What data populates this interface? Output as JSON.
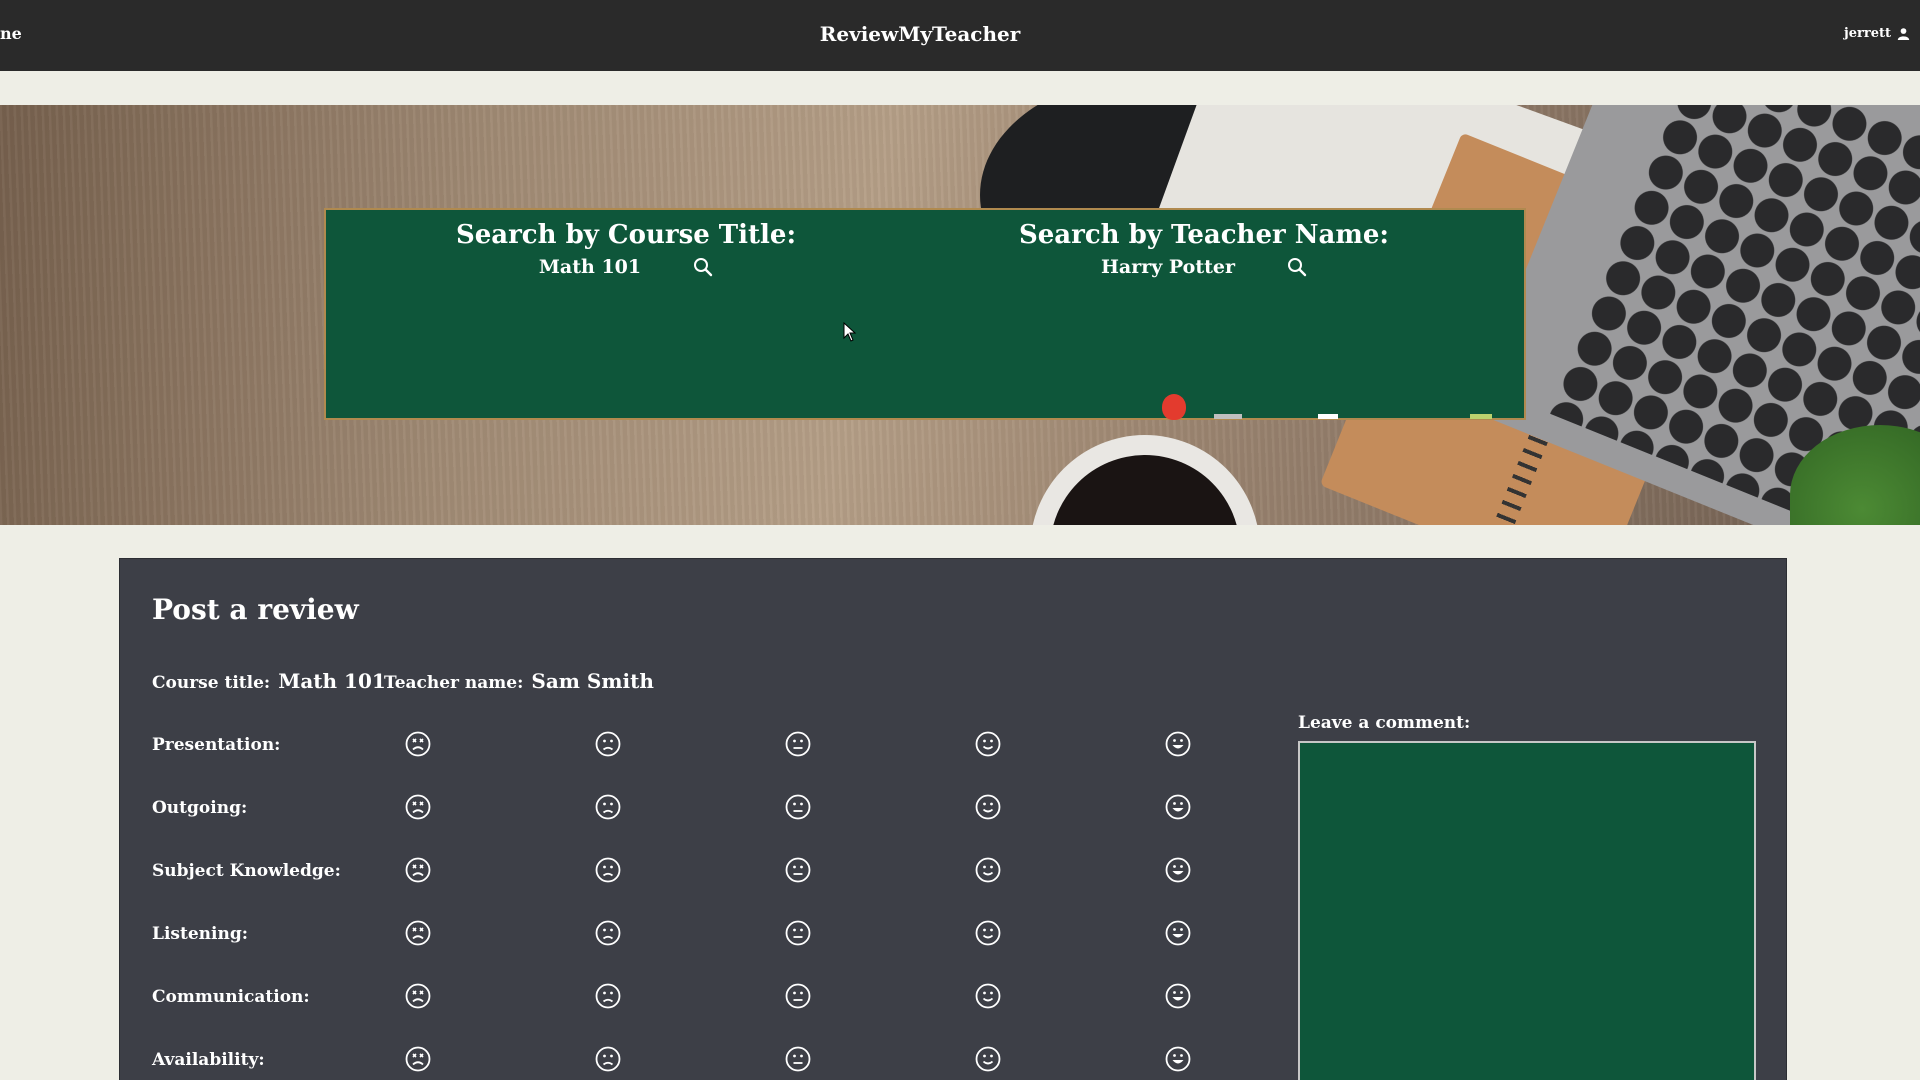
{
  "nav": {
    "home_label": "ne",
    "brand": "ReviewMyTeacher",
    "username": "jerrett"
  },
  "search": {
    "course_heading": "Search by Course Title:",
    "course_value": "Math 101",
    "teacher_heading": "Search by Teacher Name:",
    "teacher_value": "Harry Potter"
  },
  "review": {
    "title": "Post a review",
    "course_label": "Course title:",
    "course_value": "Math 101",
    "teacher_label": "Teacher name:",
    "teacher_value": "Sam Smith",
    "criteria": [
      "Presentation:",
      "Outgoing:",
      "Subject Knowledge:",
      "Listening:",
      "Communication:",
      "Availability:"
    ],
    "rating_icons": [
      "very-sad-face-icon",
      "sad-face-icon",
      "neutral-face-icon",
      "smile-face-icon",
      "big-smile-face-icon"
    ],
    "comment_label": "Leave a comment:"
  },
  "colors": {
    "nav_bg": "#2a2a2a",
    "chalkboard": "#0e563a",
    "panel_bg": "#3d3f47",
    "page_bg": "#eeeee6"
  }
}
